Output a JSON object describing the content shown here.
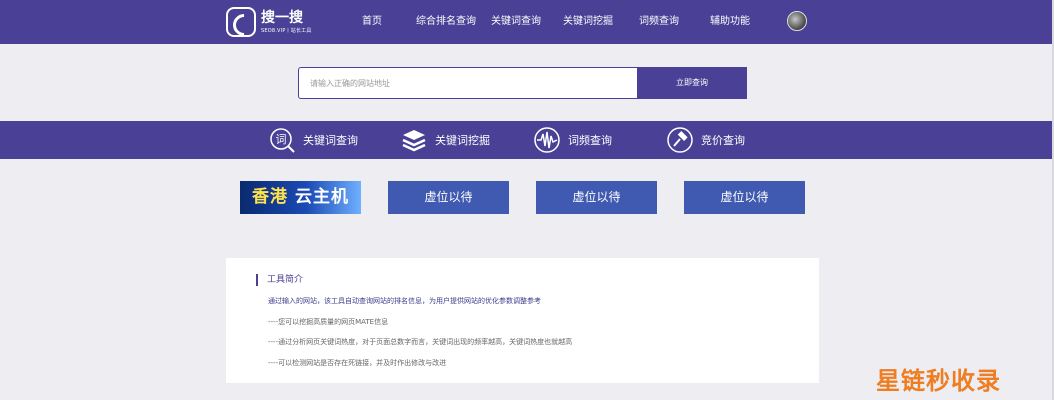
{
  "header": {
    "logo_title": "搜一搜",
    "logo_subtitle": "SEO8.VIP丨站长工具",
    "nav": [
      {
        "label": "首页"
      },
      {
        "label": "综合排名查询"
      },
      {
        "label": "关键词查询"
      },
      {
        "label": "关键词挖掘"
      },
      {
        "label": "词频查询"
      },
      {
        "label": "辅助功能"
      }
    ]
  },
  "search": {
    "placeholder": "请输入正确的网站地址",
    "button_label": "立即查询"
  },
  "tools": [
    {
      "label": "关键词查询",
      "icon": "word-search-icon"
    },
    {
      "label": "关键词挖掘",
      "icon": "layers-icon"
    },
    {
      "label": "词频查询",
      "icon": "waveform-icon"
    },
    {
      "label": "竞价查询",
      "icon": "gavel-icon"
    }
  ],
  "ads": {
    "banner_text_a": "香港",
    "banner_text_b": "云主机",
    "slots": [
      "虚位以待",
      "虚位以待",
      "虚位以待"
    ]
  },
  "intro": {
    "title": "工具简介",
    "lines": [
      "通过输入的网站，该工具自动查询网站的排名信息，为用户提供网站的优化参数调整参考",
      "----您可以挖掘高质量的网页MATE信息",
      "----通过分析网页关键词热度，对于页面总数字而言，关键词出现的频率越高，关键词热度也就越高",
      "----可以检测网站是否存在死链接，并及时作出修改与改进"
    ]
  },
  "watermark": "星链秒收录",
  "colors": {
    "brand": "#4a4196",
    "ad_slot": "#3f5ab0",
    "watermark": "#ef7d22"
  }
}
